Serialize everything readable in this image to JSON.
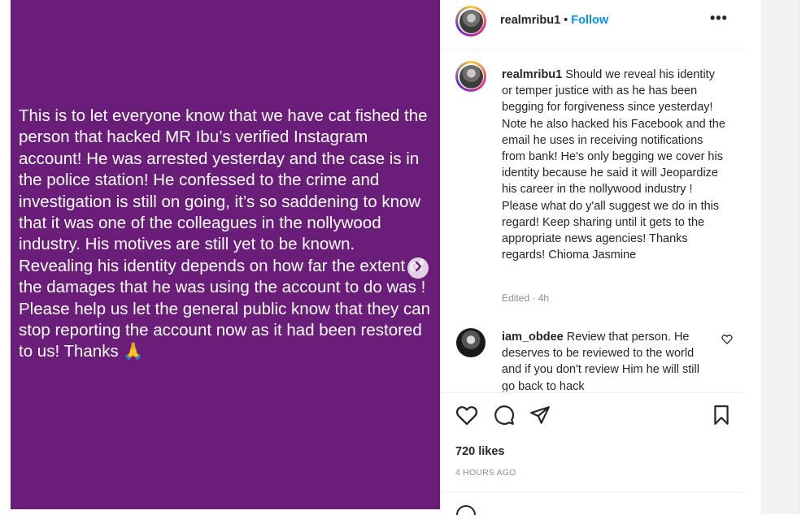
{
  "post": {
    "image_text": "This is to let everyone know that we have cat fished the person that hacked MR Ibu’s verified Instagram account! He was arrested yesterday and the case is in the police station! He confessed to the crime and investigation is still on going, it’s so saddening to know that it was one of the colleagues in the nollywood industry. His motives are still yet to be known. Revealing his identity depends on how far the extent of the damages that he was using the account to do was ! Please help us let the general public know that they can stop reporting the account now as it had been restored to us! Thanks 🙏",
    "background_color": "#6b1d7a",
    "next_icon": "chevron-right-icon"
  },
  "header": {
    "username": "realmribu1",
    "separator": "•",
    "follow_label": "Follow",
    "more_icon": "more-options-icon",
    "more_label": "•••"
  },
  "caption": {
    "username": "realmribu1",
    "text": "Should we reveal his identity or temper justice with as he has been begging for forgiveness since yesterday! Note he also hacked his Facebook and the email he uses in receiving notifications from bank! He's only begging we cover his identity because he said it will Jeopardize his career in the nollywood industry ! Please what do y'all suggest we do in this regard! Keep sharing until it gets to the appropriate news agencies! Thanks regards! Chioma Jasmine",
    "edited": "Edited · 4h"
  },
  "comment": {
    "username": "iam_obdee",
    "text": "Review that person. He deserves to be reviewed to the world and if you don't review Him he will still go back to hack"
  },
  "actions": {
    "like_icon": "heart-icon",
    "comment_icon": "comment-icon",
    "share_icon": "send-icon",
    "save_icon": "bookmark-icon"
  },
  "likes": "720 likes",
  "time_ago": "4 HOURS AGO",
  "colors": {
    "accent": "#0095f6",
    "muted": "#8e8e8e",
    "text": "#262626"
  }
}
